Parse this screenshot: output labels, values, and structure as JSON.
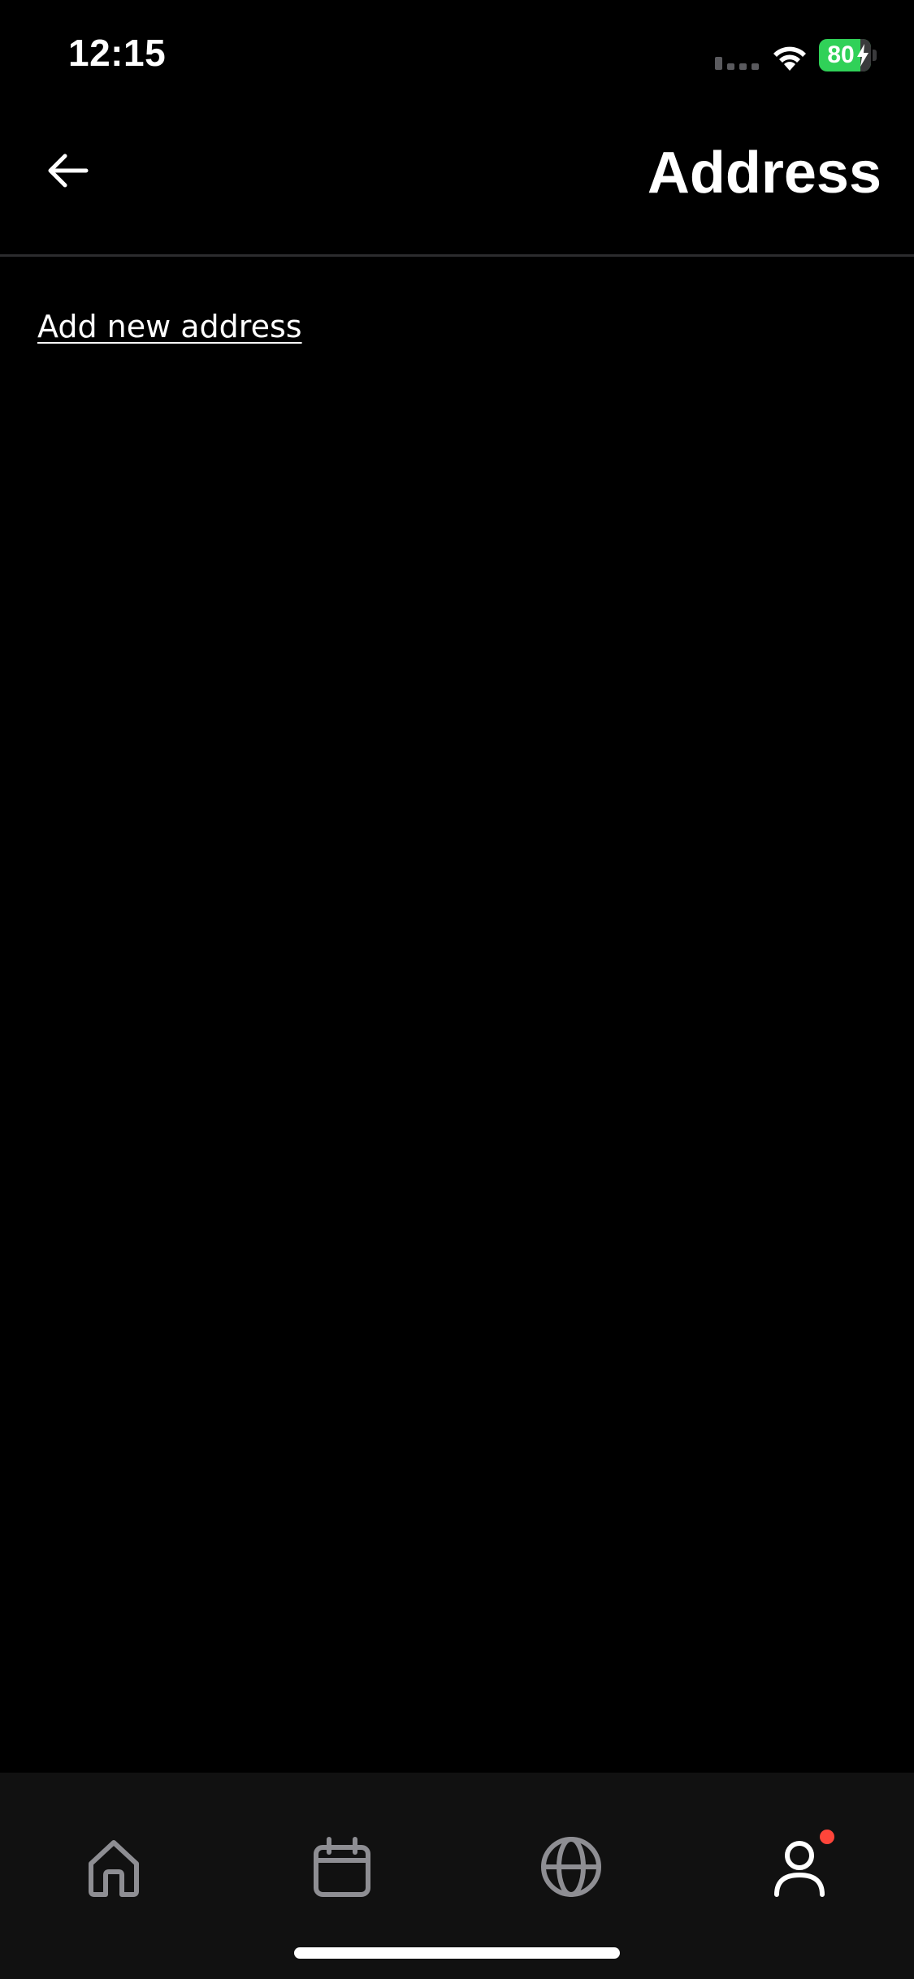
{
  "status_bar": {
    "time": "12:15",
    "battery_level": "80",
    "battery_fraction": 0.8,
    "battery_charging": true,
    "battery_color": "#30d158",
    "signal_icon": "cellular-signal-icon",
    "wifi_icon": "wifi-icon"
  },
  "header": {
    "title": "Address",
    "back_icon": "arrow-left-icon"
  },
  "main": {
    "add_address_label": "Add new address"
  },
  "tab_bar": {
    "tabs": [
      {
        "icon": "home-icon",
        "active": false
      },
      {
        "icon": "calendar-icon",
        "active": false
      },
      {
        "icon": "globe-icon",
        "active": false
      },
      {
        "icon": "user-icon",
        "active": true,
        "has_notification": true
      }
    ],
    "inactive_color": "#8e8e93",
    "active_color": "#ffffff",
    "notification_color": "#ff453a"
  }
}
